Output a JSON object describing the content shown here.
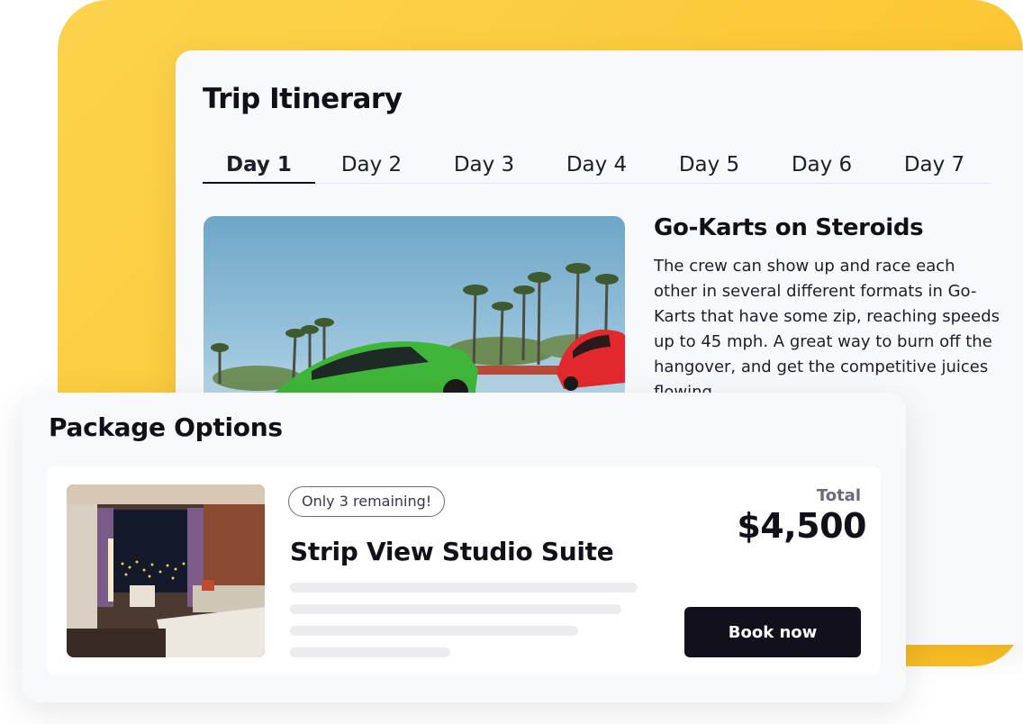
{
  "itinerary": {
    "title": "Trip Itinerary",
    "tabs": [
      "Day 1",
      "Day 2",
      "Day 3",
      "Day 4",
      "Day 5",
      "Day 6",
      "Day 7"
    ],
    "active_tab": "Day 1",
    "activity": {
      "title": "Go-Karts on Steroids",
      "description": "The crew can show up and race each other in several different formats in Go-Karts that have some zip, reaching speeds up to 45 mph. A great way to burn off the hangover, and get the competitive juices flowing."
    }
  },
  "package": {
    "title": "Package Options",
    "badge": "Only 3 remaining!",
    "name": "Strip View Studio Suite",
    "total_label": "Total",
    "price": "$4,500",
    "book_label": "Book now"
  },
  "colors": {
    "accent_yellow": "#fbbf24",
    "button_dark": "#12101a"
  }
}
